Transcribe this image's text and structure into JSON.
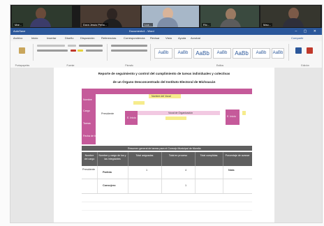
{
  "meeting": {
    "participants": [
      {
        "name": "Mar..."
      },
      {
        "name": "Dora Jesús Peña..."
      },
      {
        "name": "Luz..."
      },
      {
        "name": "Ric..."
      },
      {
        "name": "Mau..."
      }
    ]
  },
  "word": {
    "title": "Documento1 - Word",
    "left_label": "AutoSave",
    "window_controls": "–  ▢  ✕",
    "menu_tabs": [
      "Archivo",
      "Inicio",
      "Insertar",
      "Diseño",
      "Disposición",
      "Referencias",
      "Correspondencia",
      "Revisar",
      "Vista",
      "Ayuda",
      "Acrobat"
    ],
    "share": "Compartir",
    "style_sample": "AaBb",
    "groups": [
      "Portapapeles",
      "Fuente",
      "Párrafo",
      "Estilos",
      "Edición"
    ]
  },
  "document": {
    "title_line1": "Reporte de seguimiento y control del cumplimiento de tareas individuales y colectivas",
    "title_line2": "de un Órgano Desconcentrado del Instituto Electoral de Michoacán",
    "top_box_label": "Nombre del Vocal",
    "left_labels": [
      "Nombre",
      "Cargo",
      "Tareas",
      "Fecha de Inicio"
    ],
    "presidente_label": "Presidente",
    "vocal_label": "Vocal de Organización",
    "inner_left": "E. Inicio",
    "inner_right": "E. Inicio",
    "right_side": "Tarea de E. Inicio",
    "footer_banner": "Resumen general de tareas para el Consejo Municipal de Morelia",
    "table_headers": [
      "Nombre del cargo",
      "Nombre y cargo de los y las integrantes",
      "Total asignadas",
      "Total en proceso",
      "Total cumplidas",
      "Porcentaje de avance"
    ],
    "rows": [
      {
        "label": "Presidente",
        "col1": "Partido",
        "col2": "1",
        "col3": "4",
        "col4": "Nota"
      },
      {
        "label": "",
        "col1": "Consejero",
        "col2": "",
        "col3": "1",
        "col4": ""
      }
    ]
  }
}
